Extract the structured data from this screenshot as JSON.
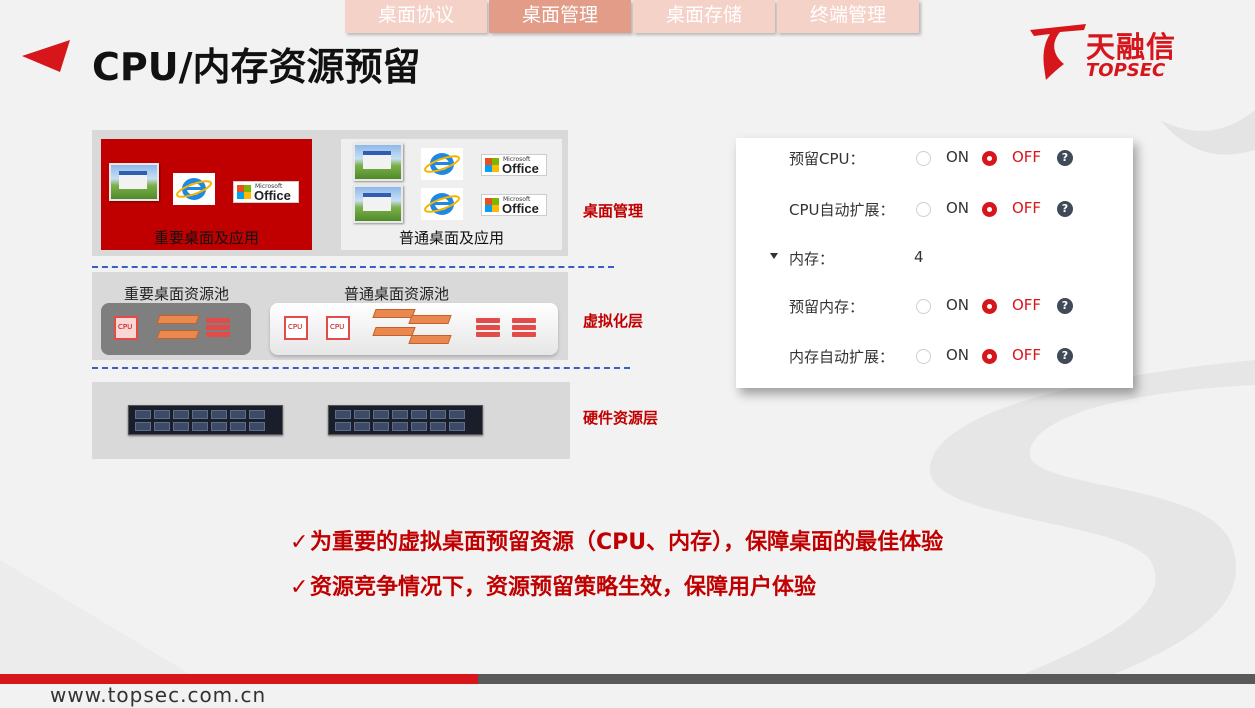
{
  "tabs": [
    "桌面协议",
    "桌面管理",
    "桌面存储",
    "终端管理"
  ],
  "active_tab": 1,
  "title": "CPU/内存资源预留",
  "logo": {
    "cn": "天融信",
    "en": "TOPSEC"
  },
  "diagram": {
    "desk_important": "重要桌面及应用",
    "desk_normal": "普通桌面及应用",
    "pool_important": "重要桌面资源池",
    "pool_normal": "普通桌面资源池",
    "layer_desktop": "桌面管理",
    "layer_virtual": "虚拟化层",
    "layer_hardware": "硬件资源层",
    "cpu_text": "CPU"
  },
  "settings": {
    "on_label": "ON",
    "off_label": "OFF",
    "help": "?",
    "reserve_cpu": "预留CPU：",
    "cpu_autoexpand": "CPU自动扩展：",
    "memory_label": "内存：",
    "memory_value": "4",
    "reserve_memory": "预留内存：",
    "memory_autoexpand": "内存自动扩展："
  },
  "bullets": [
    "为重要的虚拟桌面预留资源（CPU、内存），保障桌面的最佳体验",
    "资源竞争情况下，资源预留策略生效，保障用户体验"
  ],
  "bullet_mark": "✓",
  "footer_url": "www.topsec.com.cn",
  "colors": {
    "brand_red": "#d7161c",
    "tab_light": "#f5d2c8",
    "tab_active": "#e29c87"
  }
}
